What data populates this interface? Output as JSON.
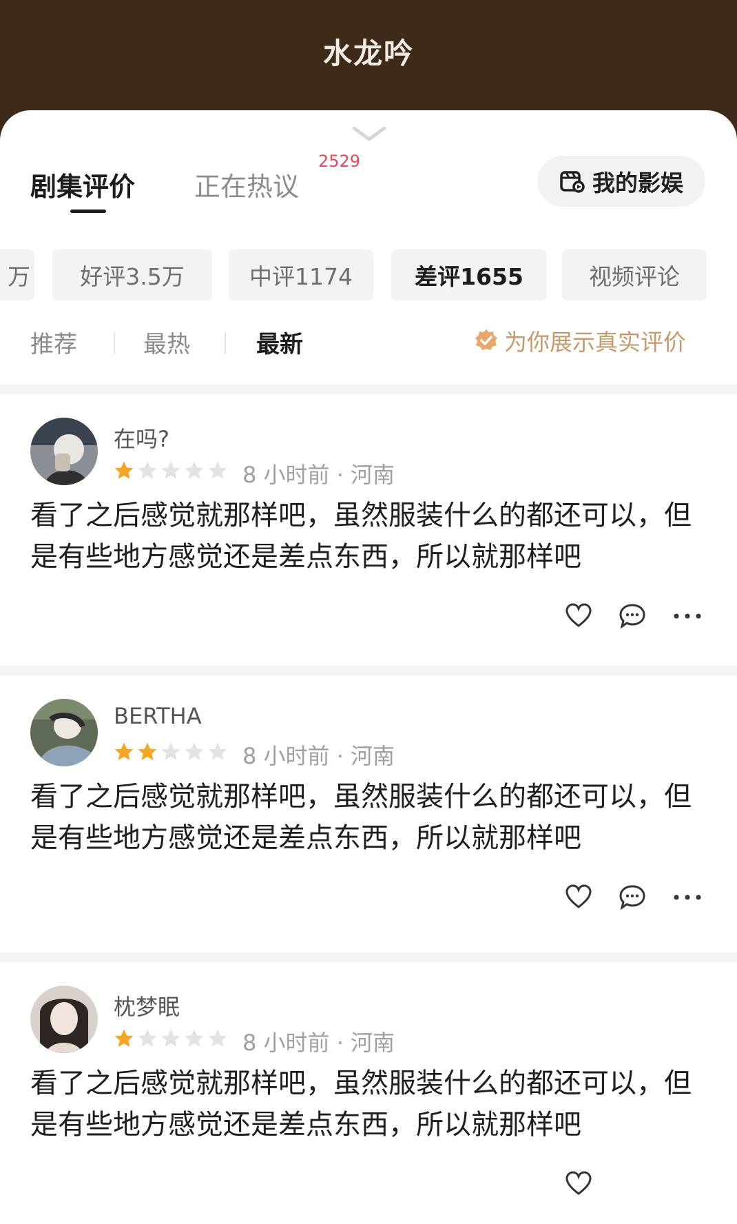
{
  "header": {
    "title": "水龙吟"
  },
  "tabs": [
    {
      "label": "剧集评价",
      "active": true
    },
    {
      "label": "正在热议",
      "badge": "2529",
      "active": false
    }
  ],
  "mine_button": {
    "label": "我的影娱",
    "icon": "film-camera-icon"
  },
  "filters": [
    {
      "label": "万",
      "active": false
    },
    {
      "label": "好评3.5万",
      "active": false
    },
    {
      "label": "中评1174",
      "active": false
    },
    {
      "label": "差评1655",
      "active": true
    },
    {
      "label": "视频评论",
      "active": false
    }
  ],
  "sort": [
    {
      "label": "推荐",
      "active": false
    },
    {
      "label": "最热",
      "active": false
    },
    {
      "label": "最新",
      "active": true
    }
  ],
  "verified_note": {
    "label": "为你展示真实评价",
    "icon": "verified-check-icon"
  },
  "colors": {
    "header_bg": "#3d2a18",
    "star_filled": "#f5a623",
    "star_empty": "#e3e3e3",
    "badge": "#e8485a"
  },
  "reviews": [
    {
      "username": "在吗?",
      "rating": 1,
      "rating_max": 5,
      "meta": "8 小时前 · 河南",
      "text": "看了之后感觉就那样吧，虽然服装什么的都还可以，但是有些地方感觉还是差点东西，所以就那样吧"
    },
    {
      "username": "BERTHA",
      "rating": 2,
      "rating_max": 5,
      "meta": "8 小时前 · 河南",
      "text": "看了之后感觉就那样吧，虽然服装什么的都还可以，但是有些地方感觉还是差点东西，所以就那样吧"
    },
    {
      "username": "枕梦眠",
      "rating": 1,
      "rating_max": 5,
      "meta": "8 小时前 · 河南",
      "text": "看了之后感觉就那样吧，虽然服装什么的都还可以，但是有些地方感觉还是差点东西，所以就那样吧"
    }
  ]
}
